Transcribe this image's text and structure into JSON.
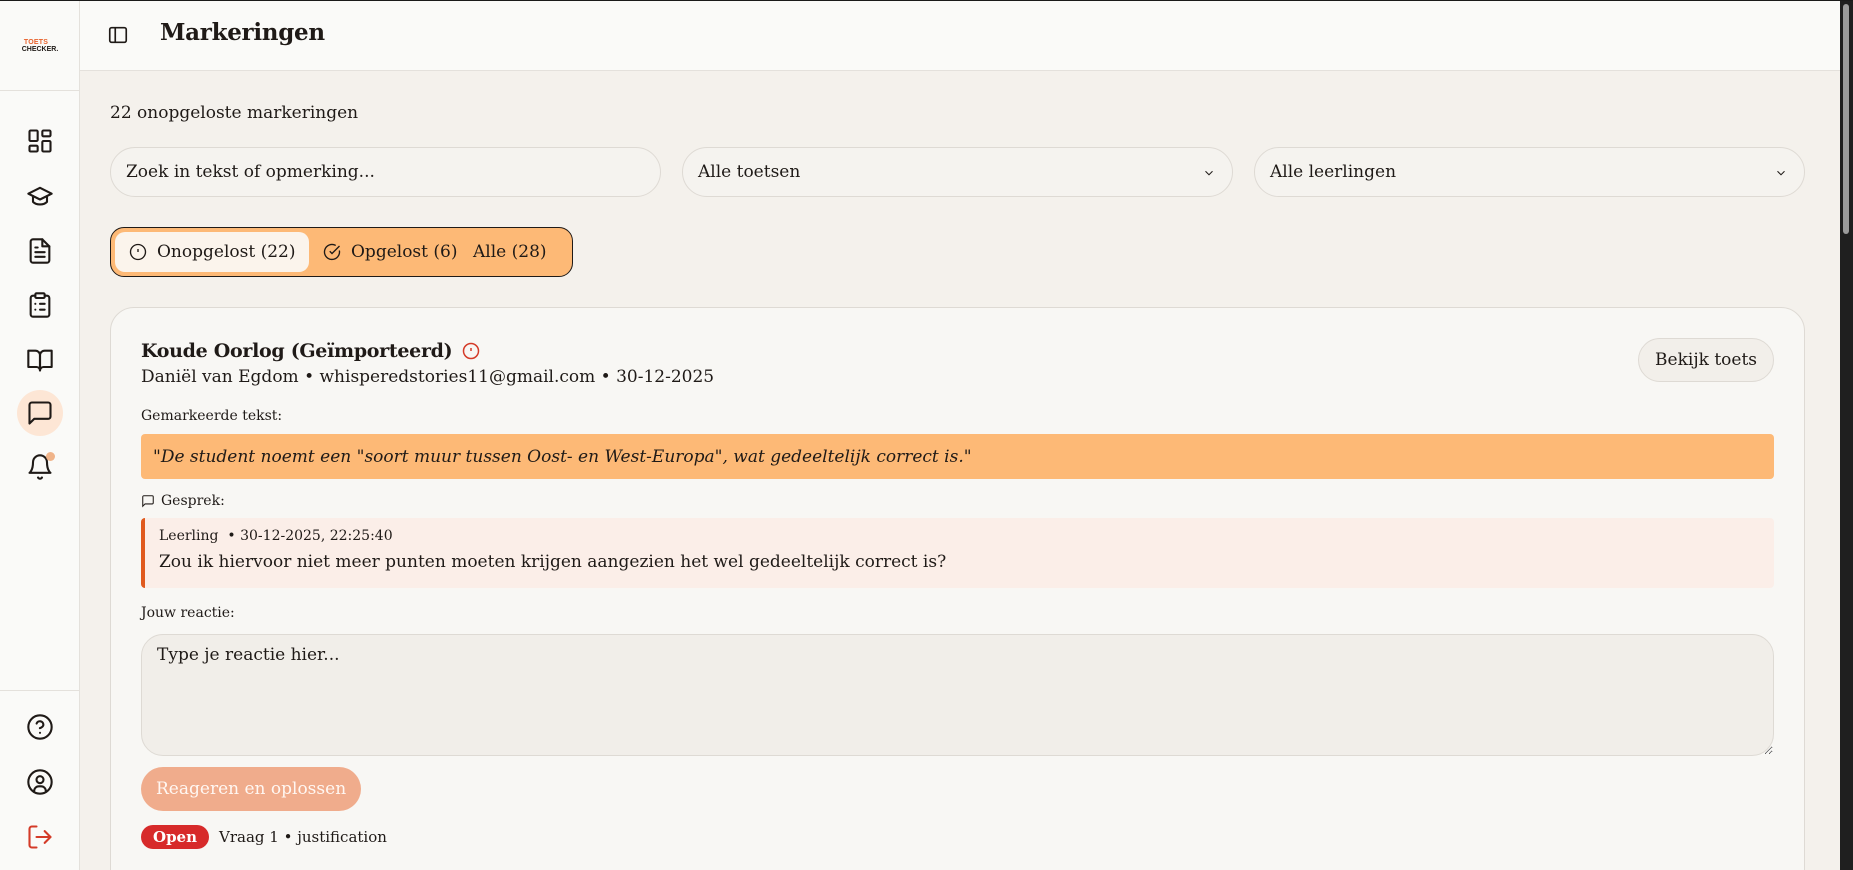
{
  "header": {
    "title": "Markeringen"
  },
  "logo": {
    "line1": "TOETS",
    "line2": "CHECKER."
  },
  "sidebar": {
    "items": [
      {
        "name": "dashboard",
        "icon": "dashboard-icon"
      },
      {
        "name": "classes",
        "icon": "graduation-cap-icon"
      },
      {
        "name": "tests",
        "icon": "file-text-icon"
      },
      {
        "name": "checklists",
        "icon": "clipboard-list-icon"
      },
      {
        "name": "library",
        "icon": "book-open-icon"
      },
      {
        "name": "markings",
        "icon": "message-square-icon",
        "active": true
      },
      {
        "name": "notifications",
        "icon": "bell-icon",
        "has_dot": true
      }
    ],
    "bottom": [
      {
        "name": "help",
        "icon": "help-circle-icon"
      },
      {
        "name": "account",
        "icon": "user-circle-icon"
      },
      {
        "name": "logout",
        "icon": "log-out-icon"
      }
    ]
  },
  "main": {
    "count_text": "22 onopgeloste markeringen",
    "search": {
      "placeholder": "Zoek in tekst of opmerking..."
    },
    "test_filter": {
      "value": "Alle toetsen"
    },
    "student_filter": {
      "value": "Alle leerlingen"
    },
    "tabs": [
      {
        "label": "Onopgelost (22)",
        "active": true
      },
      {
        "label": "Opgelost (6)",
        "active": false
      },
      {
        "label": "Alle (28)",
        "active": false
      }
    ]
  },
  "card": {
    "title": "Koude Oorlog (Geïmporteerd)",
    "meta": "Daniël van Egdom • whisperedstories11@gmail.com • 30-12-2025",
    "view_button": "Bekijk toets",
    "highlight_label": "Gemarkeerde tekst:",
    "highlight_text": "\"De student noemt een \"soort muur tussen Oost- en West-Europa\", wat gedeeltelijk correct is.\"",
    "conversation_label": "Gesprek:",
    "message": {
      "author": "Leerling",
      "timestamp": "• 30-12-2025, 22:25:40",
      "text": "Zou ik hiervoor niet meer punten moeten krijgen aangezien het wel gedeeltelijk correct is?"
    },
    "reply_label": "Jouw reactie:",
    "reply_placeholder": "Type je reactie hier...",
    "submit_label": "Reageren en oplossen",
    "status_badge": "Open",
    "question_info": "Vraag 1 • justification"
  },
  "colors": {
    "accent": "#fdb976",
    "brand_orange": "#e05a1e",
    "danger": "#d72a2a",
    "active_nav": "#fde6d5"
  }
}
